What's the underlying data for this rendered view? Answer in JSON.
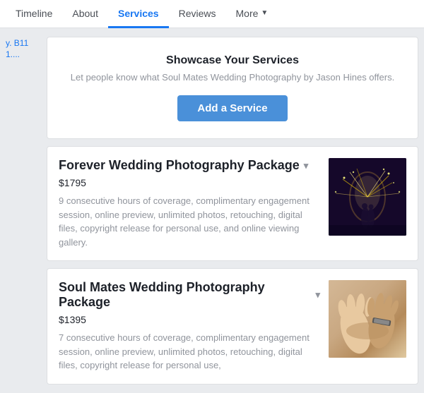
{
  "nav": {
    "tabs": [
      {
        "label": "Timeline",
        "active": false
      },
      {
        "label": "About",
        "active": false
      },
      {
        "label": "Services",
        "active": true
      },
      {
        "label": "Reviews",
        "active": false
      },
      {
        "label": "More",
        "active": false,
        "hasDropdown": true
      }
    ]
  },
  "sidebar": {
    "text": "y. B111...."
  },
  "showcase": {
    "title": "Showcase Your Services",
    "subtitle": "Let people know what Soul Mates Wedding Photography by Jason Hines offers.",
    "button_label": "Add a Service"
  },
  "services": [
    {
      "id": "service-1",
      "title": "Forever Wedding Photography Package",
      "price": "$1795",
      "description": "9 consecutive hours of coverage, complimentary engagement session, online preview, unlimited photos, retouching, digital files, copyright release for personal use, and online viewing gallery.",
      "image_alt": "wedding-sparklers-photo"
    },
    {
      "id": "service-2",
      "title": "Soul Mates Wedding Photography Package",
      "price": "$1395",
      "description": "7 consecutive hours of coverage, complimentary engagement session, online preview, unlimited photos, retouching, digital files, copyright release for personal use,",
      "image_alt": "wedding-hands-photo"
    }
  ]
}
